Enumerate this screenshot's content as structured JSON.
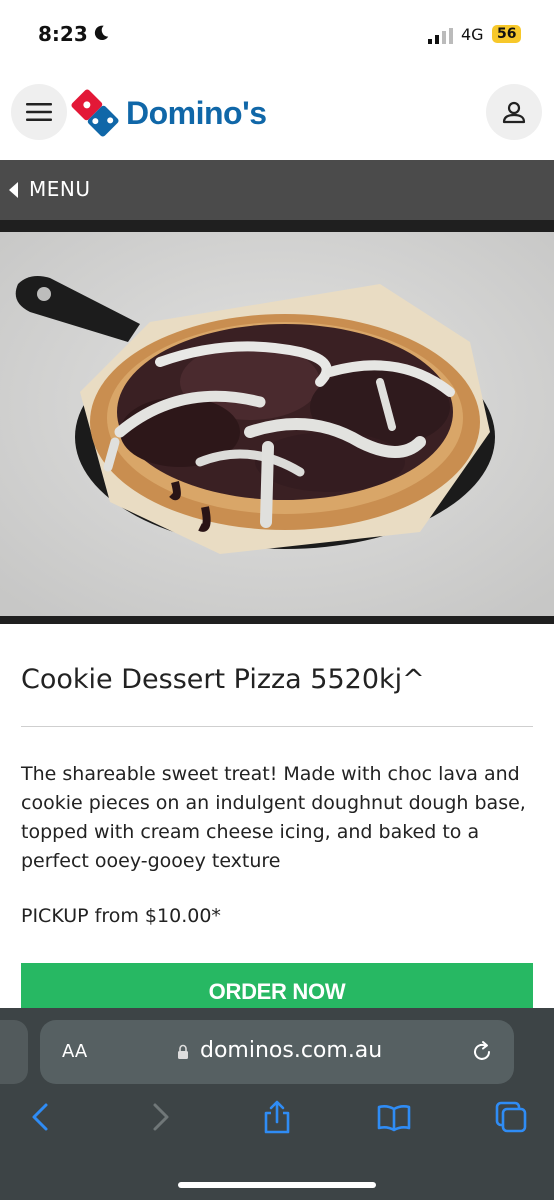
{
  "status": {
    "time": "8:23",
    "network": "4G",
    "battery": "56"
  },
  "header": {
    "brand": "Domino's"
  },
  "nav": {
    "menu_label": "MENU"
  },
  "product": {
    "title": "Cookie Dessert Pizza 5520kj^",
    "description": "The shareable sweet treat! Made with choc lava and cookie pieces on an indulgent doughnut dough base, topped with cream cheese icing, and baked to a perfect ooey-gooey texture",
    "price": "PICKUP from $10.00*",
    "cta": "ORDER NOW"
  },
  "browser": {
    "text_size": "AA",
    "url": "dominos.com.au"
  },
  "colors": {
    "brand_blue": "#1067a8",
    "brand_red": "#e31837",
    "cta_green": "#27b863",
    "menu_bar": "#4b4b4b"
  }
}
